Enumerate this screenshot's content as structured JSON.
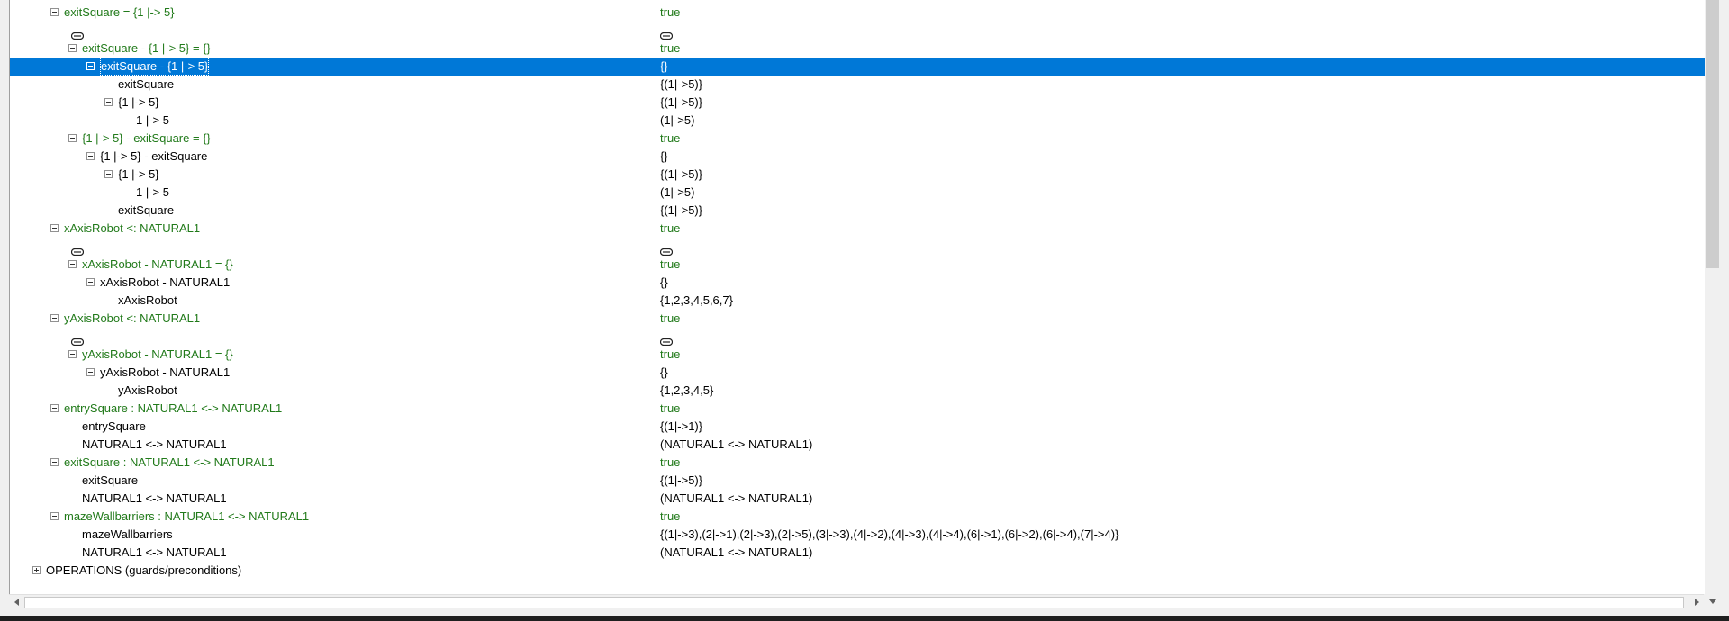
{
  "rows": [
    {
      "indent": 1,
      "expander": "minus",
      "label": "exitSquare = {1 |-> 5}",
      "value": "true",
      "green": true
    },
    {
      "indent": 3,
      "expander": "none",
      "implies": true,
      "value_implies": true
    },
    {
      "indent": 2,
      "expander": "minus",
      "label": "exitSquare - {1 |-> 5} = {}",
      "value": "true",
      "green": true
    },
    {
      "indent": 3,
      "expander": "minus",
      "label": "exitSquare - {1 |-> 5}",
      "value": "{}",
      "selected": true
    },
    {
      "indent": 5,
      "expander": "none",
      "label": "exitSquare",
      "value": "{(1|->5)}"
    },
    {
      "indent": 4,
      "expander": "minus",
      "label": "{1 |-> 5}",
      "value": "{(1|->5)}"
    },
    {
      "indent": 6,
      "expander": "none",
      "label": "1 |-> 5",
      "value": "(1|->5)"
    },
    {
      "indent": 2,
      "expander": "minus",
      "label": "{1 |-> 5} - exitSquare = {}",
      "value": "true",
      "green": true
    },
    {
      "indent": 3,
      "expander": "minus",
      "label": "{1 |-> 5} - exitSquare",
      "value": "{}"
    },
    {
      "indent": 4,
      "expander": "minus",
      "label": "{1 |-> 5}",
      "value": "{(1|->5)}"
    },
    {
      "indent": 6,
      "expander": "none",
      "label": "1 |-> 5",
      "value": "(1|->5)"
    },
    {
      "indent": 5,
      "expander": "none",
      "label": "exitSquare",
      "value": "{(1|->5)}"
    },
    {
      "indent": 1,
      "expander": "minus",
      "label": "xAxisRobot <: NATURAL1",
      "value": "true",
      "green": true
    },
    {
      "indent": 3,
      "expander": "none",
      "implies": true,
      "value_implies": true
    },
    {
      "indent": 2,
      "expander": "minus",
      "label": "xAxisRobot - NATURAL1 = {}",
      "value": "true",
      "green": true
    },
    {
      "indent": 3,
      "expander": "minus",
      "label": "xAxisRobot - NATURAL1",
      "value": "{}"
    },
    {
      "indent": 5,
      "expander": "none",
      "label": "xAxisRobot",
      "value": "{1,2,3,4,5,6,7}"
    },
    {
      "indent": 1,
      "expander": "minus",
      "label": "yAxisRobot <: NATURAL1",
      "value": "true",
      "green": true
    },
    {
      "indent": 3,
      "expander": "none",
      "implies": true,
      "value_implies": true
    },
    {
      "indent": 2,
      "expander": "minus",
      "label": "yAxisRobot - NATURAL1 = {}",
      "value": "true",
      "green": true
    },
    {
      "indent": 3,
      "expander": "minus",
      "label": "yAxisRobot - NATURAL1",
      "value": "{}"
    },
    {
      "indent": 5,
      "expander": "none",
      "label": "yAxisRobot",
      "value": "{1,2,3,4,5}"
    },
    {
      "indent": 1,
      "expander": "minus",
      "label": "entrySquare : NATURAL1 <-> NATURAL1",
      "value": "true",
      "green": true
    },
    {
      "indent": 3,
      "expander": "none",
      "label": "entrySquare",
      "value": "{(1|->1)}"
    },
    {
      "indent": 3,
      "expander": "none",
      "label": "NATURAL1 <-> NATURAL1",
      "value": "(NATURAL1 <-> NATURAL1)"
    },
    {
      "indent": 1,
      "expander": "minus",
      "label": "exitSquare : NATURAL1 <-> NATURAL1",
      "value": "true",
      "green": true
    },
    {
      "indent": 3,
      "expander": "none",
      "label": "exitSquare",
      "value": "{(1|->5)}"
    },
    {
      "indent": 3,
      "expander": "none",
      "label": "NATURAL1 <-> NATURAL1",
      "value": "(NATURAL1 <-> NATURAL1)"
    },
    {
      "indent": 1,
      "expander": "minus",
      "label": "mazeWallbarriers : NATURAL1 <-> NATURAL1",
      "value": "true",
      "green": true
    },
    {
      "indent": 3,
      "expander": "none",
      "label": "mazeWallbarriers",
      "value": "{(1|->3),(2|->1),(2|->3),(2|->5),(3|->3),(4|->2),(4|->3),(4|->4),(6|->1),(6|->2),(6|->4),(7|->4)}"
    },
    {
      "indent": 3,
      "expander": "none",
      "label": "NATURAL1 <-> NATURAL1",
      "value": "(NATURAL1 <-> NATURAL1)"
    },
    {
      "indent": 0,
      "expander": "plus",
      "label": "OPERATIONS (guards/preconditions)",
      "value": ""
    }
  ],
  "colors": {
    "green": "#217a1a",
    "selection": "#0078d7"
  }
}
